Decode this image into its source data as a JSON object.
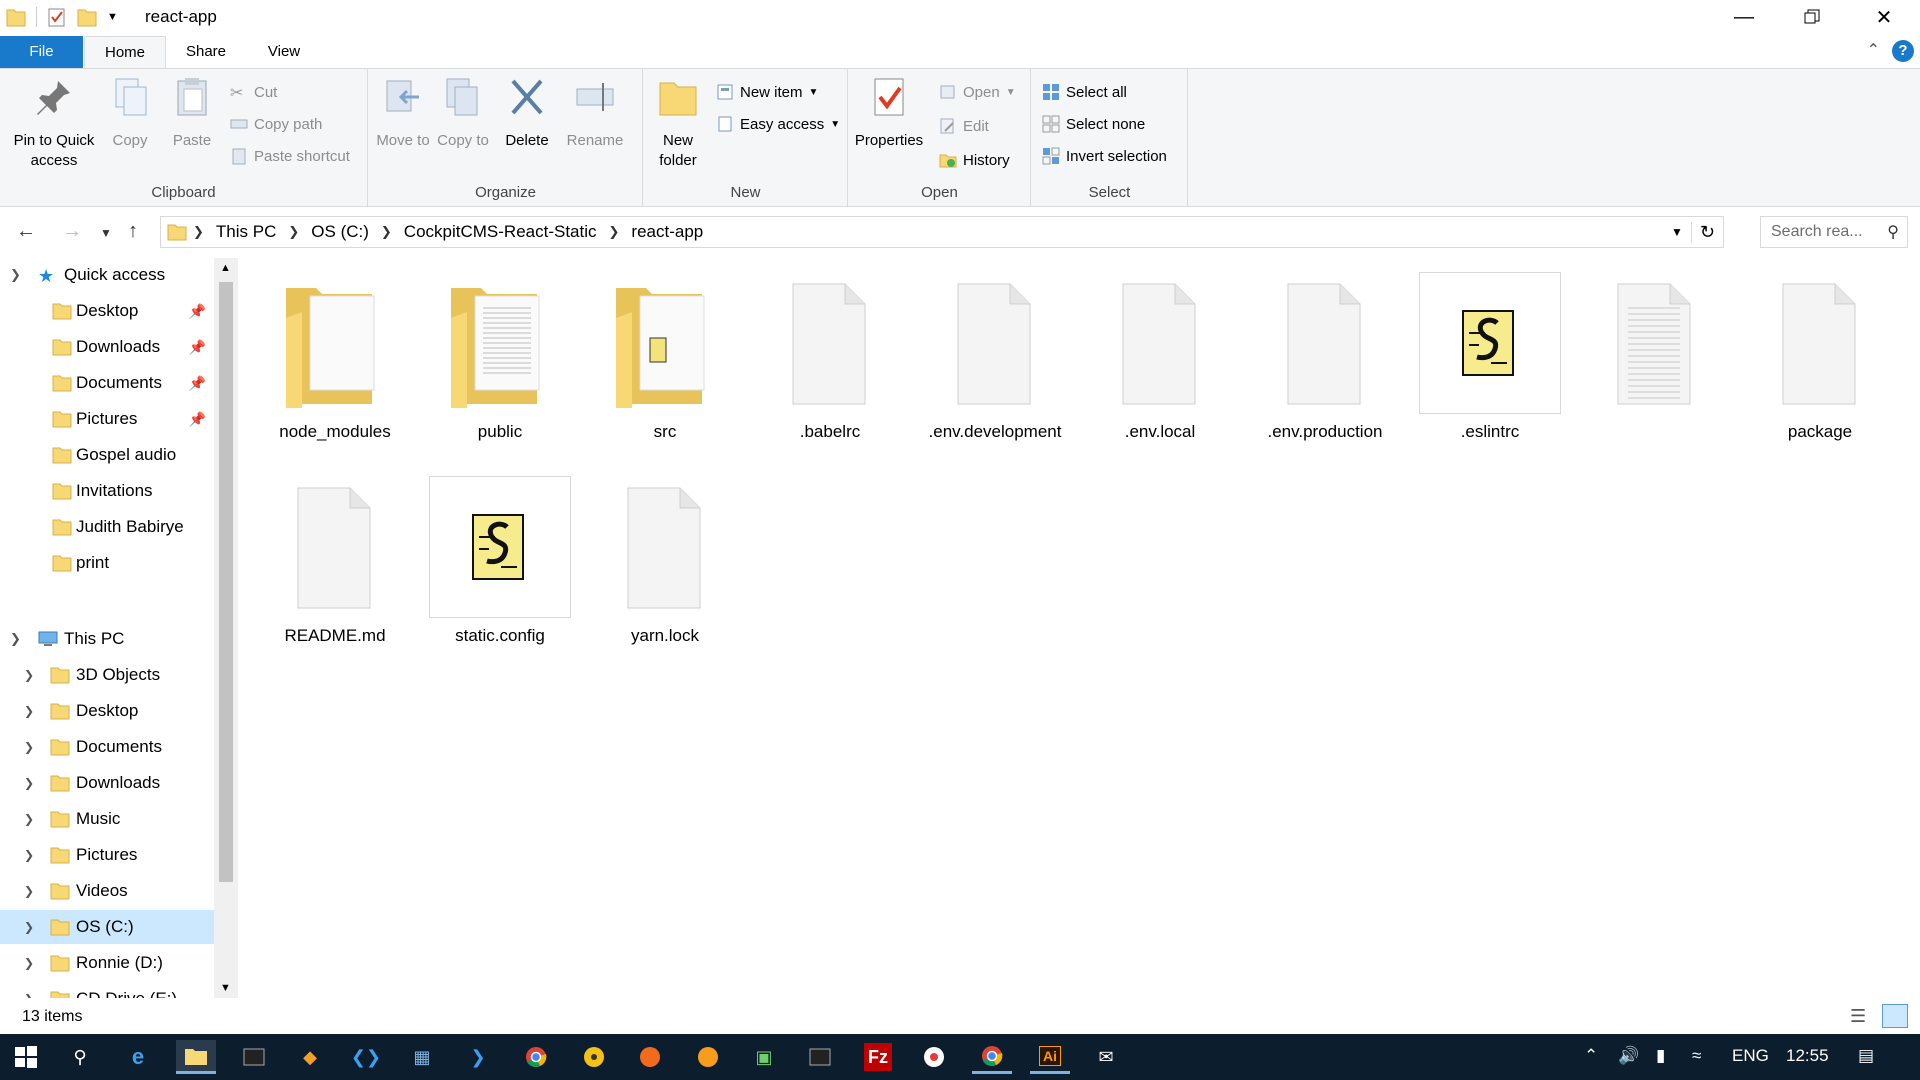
{
  "window": {
    "title": "react-app"
  },
  "ribbon_tabs": [
    "File",
    "Home",
    "Share",
    "View"
  ],
  "ribbon": {
    "clipboard": {
      "label": "Clipboard",
      "pin_to_quick_access": "Pin to Quick access",
      "copy": "Copy",
      "paste": "Paste",
      "cut": "Cut",
      "copy_path": "Copy path",
      "paste_shortcut": "Paste shortcut"
    },
    "organize": {
      "label": "Organize",
      "move_to": "Move to",
      "copy_to": "Copy to",
      "delete": "Delete",
      "rename": "Rename"
    },
    "new": {
      "label": "New",
      "new_folder": "New folder",
      "new_item": "New item",
      "easy_access": "Easy access"
    },
    "open": {
      "label": "Open",
      "properties": "Properties",
      "open": "Open",
      "edit": "Edit",
      "history": "History"
    },
    "select": {
      "label": "Select",
      "select_all": "Select all",
      "select_none": "Select none",
      "invert_selection": "Invert selection"
    }
  },
  "breadcrumb": [
    "This PC",
    "OS (C:)",
    "CockpitCMS-React-Static",
    "react-app"
  ],
  "search": {
    "placeholder": "Search rea..."
  },
  "nav": {
    "quick_access": "Quick access",
    "quick_items": [
      {
        "label": "Desktop",
        "pinned": true
      },
      {
        "label": "Downloads",
        "pinned": true
      },
      {
        "label": "Documents",
        "pinned": true
      },
      {
        "label": "Pictures",
        "pinned": true
      },
      {
        "label": "Gospel audio",
        "pinned": false
      },
      {
        "label": "Invitations",
        "pinned": false
      },
      {
        "label": "Judith Babirye",
        "pinned": false
      },
      {
        "label": "print",
        "pinned": false
      }
    ],
    "this_pc": "This PC",
    "pc_items": [
      "3D Objects",
      "Desktop",
      "Documents",
      "Downloads",
      "Music",
      "Pictures",
      "Videos",
      "OS (C:)",
      "Ronnie (D:)",
      "CD Drive (E:)"
    ],
    "selected": "OS (C:)"
  },
  "files": [
    {
      "name": "node_modules",
      "type": "folder"
    },
    {
      "name": "public",
      "type": "folder-doc"
    },
    {
      "name": "src",
      "type": "folder-script"
    },
    {
      "name": ".babelrc",
      "type": "file"
    },
    {
      "name": ".env.development",
      "type": "file"
    },
    {
      "name": ".env.local",
      "type": "file"
    },
    {
      "name": ".env.production",
      "type": "file"
    },
    {
      "name": ".eslintrc",
      "type": "script"
    },
    {
      "name": "",
      "type": "text"
    },
    {
      "name": "package",
      "type": "file"
    },
    {
      "name": "README.md",
      "type": "file"
    },
    {
      "name": "static.config",
      "type": "script"
    },
    {
      "name": "yarn.lock",
      "type": "file"
    }
  ],
  "status": {
    "count": "13 items"
  },
  "taskbar": {
    "language": "ENG",
    "time": "12:55"
  }
}
